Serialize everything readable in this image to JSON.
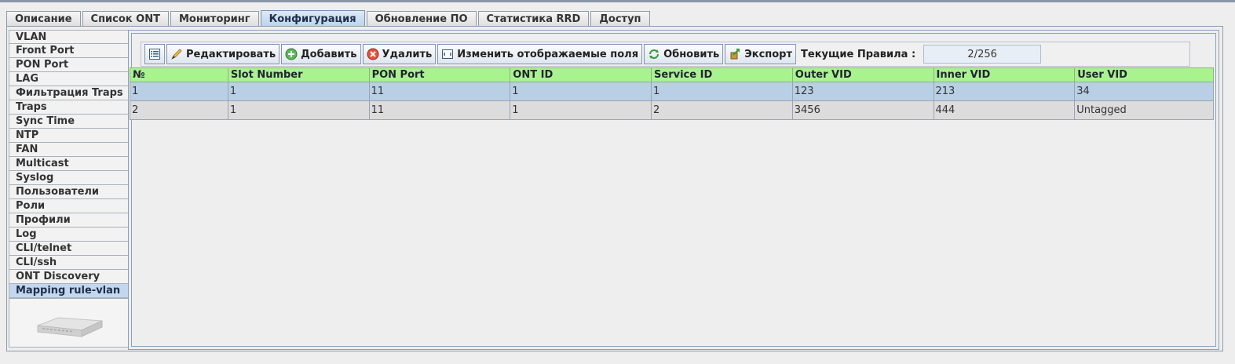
{
  "top_tabs": [
    {
      "label": "Описание"
    },
    {
      "label": "Список ONT"
    },
    {
      "label": "Мониторинг"
    },
    {
      "label": "Конфигурация",
      "active": true
    },
    {
      "label": "Обновление ПО"
    },
    {
      "label": "Статистика RRD"
    },
    {
      "label": "Доступ"
    }
  ],
  "side_tabs": [
    "VLAN",
    "Front Port",
    "PON Port",
    "LAG",
    "Фильтрация Traps",
    "Traps",
    "Sync Time",
    "NTP",
    "FAN",
    "Multicast",
    "Syslog",
    "Пользователи",
    "Роли",
    "Профили",
    "Log",
    "CLI/telnet",
    "CLI/ssh",
    "ONT Discovery",
    "Mapping rule-vlan"
  ],
  "side_active": "Mapping rule-vlan",
  "toolbar": {
    "edit_label": "Редактировать",
    "add_label": "Добавить",
    "delete_label": "Удалить",
    "fields_label": "Изменить отображаемые поля",
    "refresh_label": "Обновить",
    "export_label": "Экспорт",
    "rules_label": "Текущие Правила :",
    "rules_value": "2/256"
  },
  "table": {
    "columns": [
      "№",
      "Slot Number",
      "PON Port",
      "ONT ID",
      "Service ID",
      "Outer VID",
      "Inner VID",
      "User VID"
    ],
    "rows": [
      [
        "1",
        "1",
        "11",
        "1",
        "1",
        "123",
        "213",
        "34"
      ],
      [
        "2",
        "1",
        "11",
        "1",
        "2",
        "3456",
        "444",
        "Untagged"
      ]
    ],
    "selected_row": 0
  },
  "colors": {
    "header_bg": "#a9f38f",
    "selected_row": "#b8cfe6",
    "active_tab": "#bcd3ee"
  }
}
